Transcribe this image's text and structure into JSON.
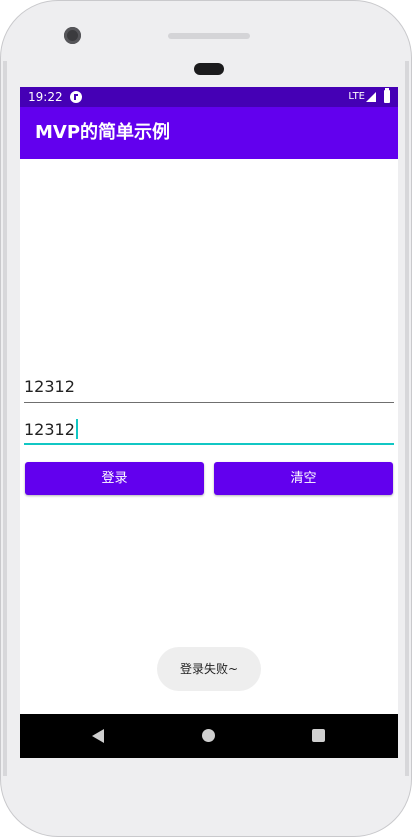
{
  "status_bar": {
    "time": "19:22",
    "network": "LTE",
    "icons": [
      "notification-app-icon",
      "signal-icon",
      "battery-icon"
    ]
  },
  "app_bar": {
    "title": "MVP的简单示例"
  },
  "form": {
    "username_value": "12312",
    "password_value": "12312"
  },
  "buttons": {
    "login_label": "登录",
    "clear_label": "清空"
  },
  "toast": {
    "message": "登录失败~"
  },
  "nav_bar": {
    "icons": [
      "back-icon",
      "home-icon",
      "recents-icon"
    ]
  },
  "colors": {
    "primary": "#6200ee",
    "primary_dark": "#4500b5",
    "accent": "#11c7c4"
  }
}
